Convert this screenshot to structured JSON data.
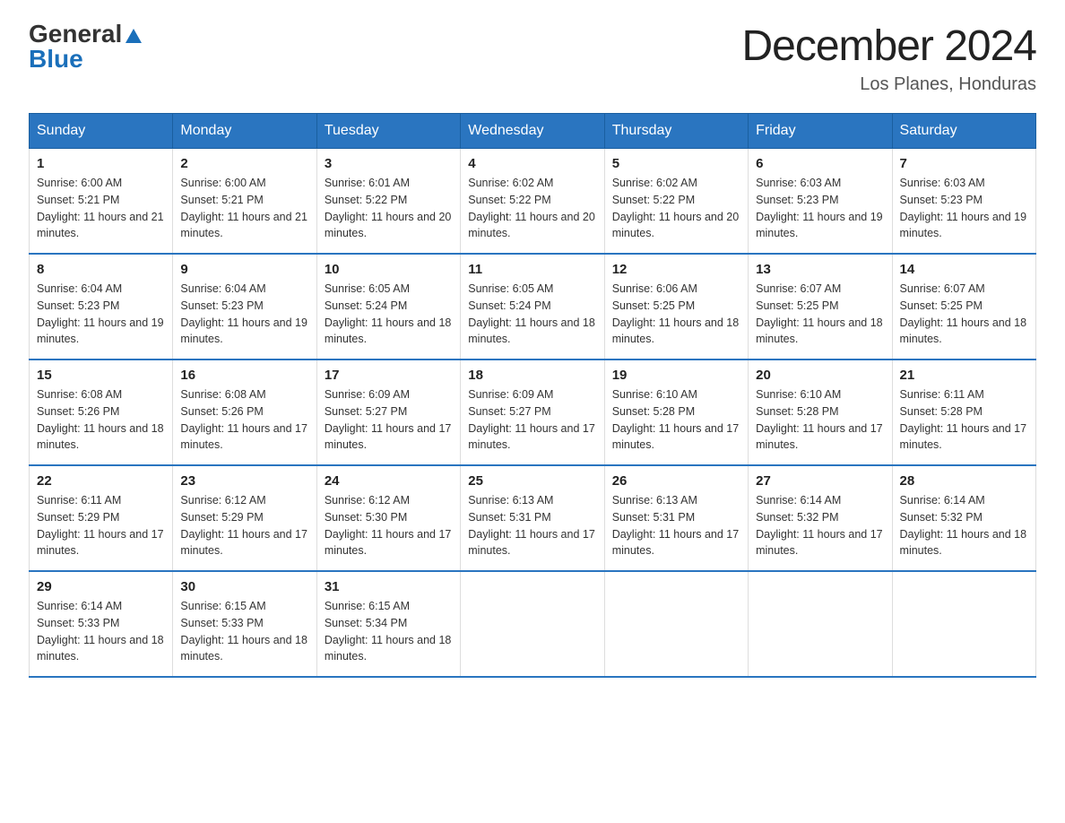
{
  "logo": {
    "general": "General",
    "triangle": "▶",
    "blue": "Blue"
  },
  "title": "December 2024",
  "subtitle": "Los Planes, Honduras",
  "days_header": [
    "Sunday",
    "Monday",
    "Tuesday",
    "Wednesday",
    "Thursday",
    "Friday",
    "Saturday"
  ],
  "weeks": [
    [
      {
        "day": "1",
        "sunrise": "6:00 AM",
        "sunset": "5:21 PM",
        "daylight": "11 hours and 21 minutes."
      },
      {
        "day": "2",
        "sunrise": "6:00 AM",
        "sunset": "5:21 PM",
        "daylight": "11 hours and 21 minutes."
      },
      {
        "day": "3",
        "sunrise": "6:01 AM",
        "sunset": "5:22 PM",
        "daylight": "11 hours and 20 minutes."
      },
      {
        "day": "4",
        "sunrise": "6:02 AM",
        "sunset": "5:22 PM",
        "daylight": "11 hours and 20 minutes."
      },
      {
        "day": "5",
        "sunrise": "6:02 AM",
        "sunset": "5:22 PM",
        "daylight": "11 hours and 20 minutes."
      },
      {
        "day": "6",
        "sunrise": "6:03 AM",
        "sunset": "5:23 PM",
        "daylight": "11 hours and 19 minutes."
      },
      {
        "day": "7",
        "sunrise": "6:03 AM",
        "sunset": "5:23 PM",
        "daylight": "11 hours and 19 minutes."
      }
    ],
    [
      {
        "day": "8",
        "sunrise": "6:04 AM",
        "sunset": "5:23 PM",
        "daylight": "11 hours and 19 minutes."
      },
      {
        "day": "9",
        "sunrise": "6:04 AM",
        "sunset": "5:23 PM",
        "daylight": "11 hours and 19 minutes."
      },
      {
        "day": "10",
        "sunrise": "6:05 AM",
        "sunset": "5:24 PM",
        "daylight": "11 hours and 18 minutes."
      },
      {
        "day": "11",
        "sunrise": "6:05 AM",
        "sunset": "5:24 PM",
        "daylight": "11 hours and 18 minutes."
      },
      {
        "day": "12",
        "sunrise": "6:06 AM",
        "sunset": "5:25 PM",
        "daylight": "11 hours and 18 minutes."
      },
      {
        "day": "13",
        "sunrise": "6:07 AM",
        "sunset": "5:25 PM",
        "daylight": "11 hours and 18 minutes."
      },
      {
        "day": "14",
        "sunrise": "6:07 AM",
        "sunset": "5:25 PM",
        "daylight": "11 hours and 18 minutes."
      }
    ],
    [
      {
        "day": "15",
        "sunrise": "6:08 AM",
        "sunset": "5:26 PM",
        "daylight": "11 hours and 18 minutes."
      },
      {
        "day": "16",
        "sunrise": "6:08 AM",
        "sunset": "5:26 PM",
        "daylight": "11 hours and 17 minutes."
      },
      {
        "day": "17",
        "sunrise": "6:09 AM",
        "sunset": "5:27 PM",
        "daylight": "11 hours and 17 minutes."
      },
      {
        "day": "18",
        "sunrise": "6:09 AM",
        "sunset": "5:27 PM",
        "daylight": "11 hours and 17 minutes."
      },
      {
        "day": "19",
        "sunrise": "6:10 AM",
        "sunset": "5:28 PM",
        "daylight": "11 hours and 17 minutes."
      },
      {
        "day": "20",
        "sunrise": "6:10 AM",
        "sunset": "5:28 PM",
        "daylight": "11 hours and 17 minutes."
      },
      {
        "day": "21",
        "sunrise": "6:11 AM",
        "sunset": "5:28 PM",
        "daylight": "11 hours and 17 minutes."
      }
    ],
    [
      {
        "day": "22",
        "sunrise": "6:11 AM",
        "sunset": "5:29 PM",
        "daylight": "11 hours and 17 minutes."
      },
      {
        "day": "23",
        "sunrise": "6:12 AM",
        "sunset": "5:29 PM",
        "daylight": "11 hours and 17 minutes."
      },
      {
        "day": "24",
        "sunrise": "6:12 AM",
        "sunset": "5:30 PM",
        "daylight": "11 hours and 17 minutes."
      },
      {
        "day": "25",
        "sunrise": "6:13 AM",
        "sunset": "5:31 PM",
        "daylight": "11 hours and 17 minutes."
      },
      {
        "day": "26",
        "sunrise": "6:13 AM",
        "sunset": "5:31 PM",
        "daylight": "11 hours and 17 minutes."
      },
      {
        "day": "27",
        "sunrise": "6:14 AM",
        "sunset": "5:32 PM",
        "daylight": "11 hours and 17 minutes."
      },
      {
        "day": "28",
        "sunrise": "6:14 AM",
        "sunset": "5:32 PM",
        "daylight": "11 hours and 18 minutes."
      }
    ],
    [
      {
        "day": "29",
        "sunrise": "6:14 AM",
        "sunset": "5:33 PM",
        "daylight": "11 hours and 18 minutes."
      },
      {
        "day": "30",
        "sunrise": "6:15 AM",
        "sunset": "5:33 PM",
        "daylight": "11 hours and 18 minutes."
      },
      {
        "day": "31",
        "sunrise": "6:15 AM",
        "sunset": "5:34 PM",
        "daylight": "11 hours and 18 minutes."
      },
      null,
      null,
      null,
      null
    ]
  ]
}
